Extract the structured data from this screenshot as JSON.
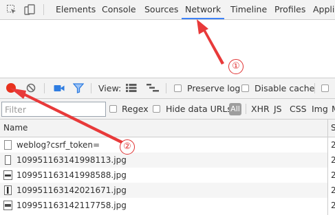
{
  "tabs": [
    {
      "label": "Elements"
    },
    {
      "label": "Console"
    },
    {
      "label": "Sources"
    },
    {
      "label": "Network"
    },
    {
      "label": "Timeline"
    },
    {
      "label": "Profiles"
    },
    {
      "label": "Appli"
    }
  ],
  "selected_tab": "Network",
  "toolbar": {
    "view_label": "View:",
    "preserve_log": "Preserve log",
    "disable_cache": "Disable cache"
  },
  "filterbar": {
    "placeholder": "Filter",
    "regex": "Regex",
    "hide_data_urls": "Hide data URLs",
    "all": "All",
    "types": [
      "XHR",
      "JS",
      "CSS",
      "Img",
      "M"
    ]
  },
  "table": {
    "name_header": "Name",
    "status_header": "S",
    "rows": [
      {
        "name": "weblog?csrf_token=",
        "status": "2"
      },
      {
        "name": "109951163141998113.jpg",
        "status": "2"
      },
      {
        "name": "109951163141998588.jpg",
        "status": "2"
      },
      {
        "name": "109951163142021671.jpg",
        "status": "2"
      },
      {
        "name": "109951163142117758.jpg",
        "status": "2"
      }
    ]
  },
  "annotations": {
    "marker1": "①",
    "marker2": "②",
    "color": "#e03030"
  },
  "colors": {
    "accent": "#3e82f7",
    "record": "#e8321e"
  }
}
